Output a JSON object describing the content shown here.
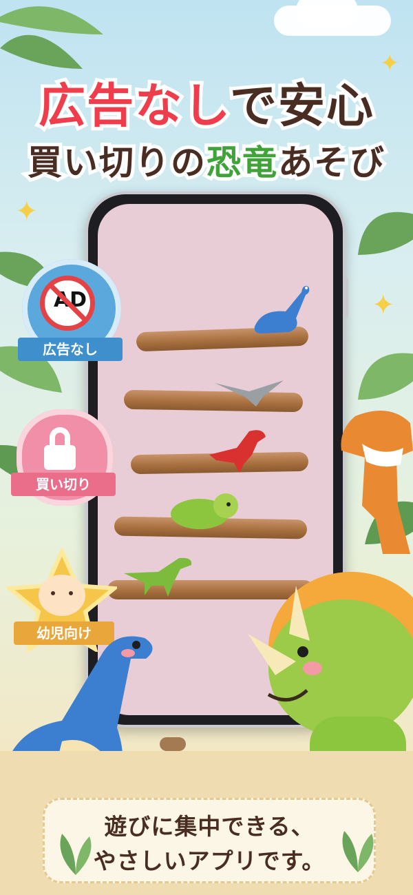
{
  "headline": {
    "line1": [
      "広告なし",
      "で安心"
    ],
    "line2": [
      "買い切りの",
      "恐竜",
      "あそび"
    ]
  },
  "badges": [
    {
      "ribbon": "広告なし",
      "icon_text": "AD",
      "icon": "no-ad-icon",
      "color": "#5aa8dc"
    },
    {
      "ribbon": "買い切り",
      "icon": "lock-icon",
      "color": "#ef7f99"
    },
    {
      "ribbon": "幼児向け",
      "icon": "baby-face-icon",
      "color": "#f2b84a"
    }
  ],
  "bottom_caption": {
    "line1": "遊びに集中できる、",
    "line2": "やさしいアプリです。"
  },
  "colors": {
    "accent_red": "#ef3d4c",
    "text_brown": "#4a2d22",
    "accent_green": "#3fa33a",
    "screen_bg": "#e9cdd6"
  }
}
